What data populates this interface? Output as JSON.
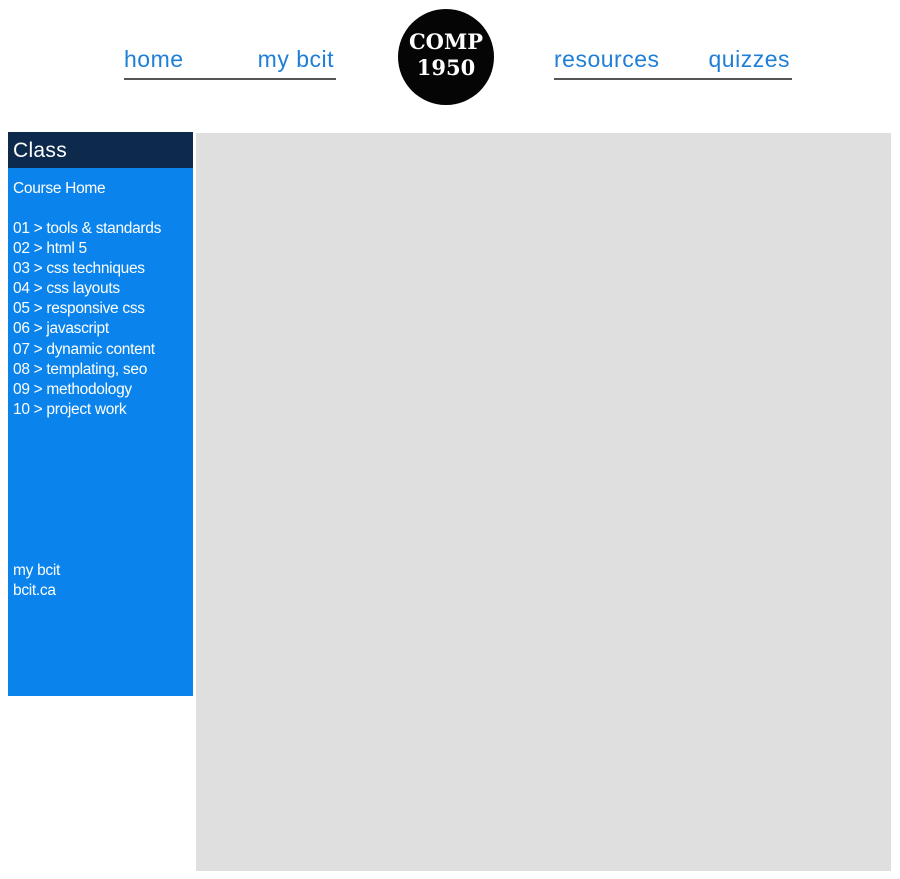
{
  "nav": {
    "home": "home",
    "mybcit": "my bcit",
    "resources": "resources",
    "quizzes": "quizzes"
  },
  "logo": {
    "line1": "COMP",
    "line2": "1950"
  },
  "sidebar": {
    "title": "Class",
    "course_home": "Course Home",
    "units": [
      "01 > tools & standards",
      "02 > html 5",
      "03 > css techniques",
      "04 > css layouts",
      "05 > responsive css",
      "06 > javascript",
      "07 > dynamic content",
      "08 > templating, seo",
      "09 > methodology",
      "10 > project work"
    ],
    "extra_links": [
      "my bcit",
      "bcit.ca"
    ]
  },
  "colors": {
    "nav_link": "#1f7fd6",
    "sidebar_bg": "#0a84ec",
    "sidebar_header_bg": "#0d2a4d",
    "main_bg": "#dfdfdf",
    "logo_bg": "#050505"
  }
}
